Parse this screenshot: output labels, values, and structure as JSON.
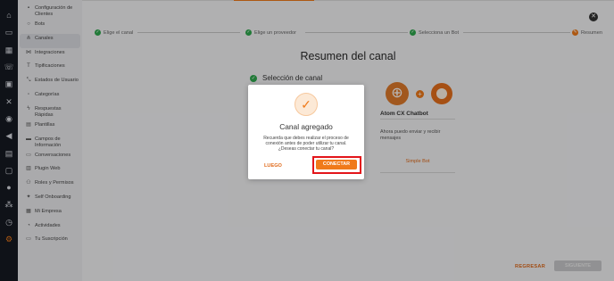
{
  "rail": {
    "icons": [
      "home-icon",
      "chat-bubbles-icon",
      "grid-icon",
      "phone-icon",
      "contacts-icon",
      "phone-off-icon",
      "whatsapp-icon",
      "megaphone-icon",
      "layers-icon",
      "message-icon",
      "user-icon",
      "team-icon",
      "alarm-clock-icon",
      "gear-icon"
    ],
    "active_index": 13
  },
  "submenu": {
    "items": [
      {
        "icon": "id-card-icon",
        "label": "Configuración de Clientes"
      },
      {
        "icon": "bot-icon",
        "label": "Bots"
      },
      {
        "icon": "channels-icon",
        "label": "Canales"
      },
      {
        "icon": "integrations-icon",
        "label": "Integraciones"
      },
      {
        "icon": "text-icon",
        "label": "Tipificaciones"
      },
      {
        "icon": "status-icon",
        "label": "Estados de Usuario"
      },
      {
        "icon": "category-icon",
        "label": "Categorías"
      },
      {
        "icon": "bolt-icon",
        "label": "Respuestas Rápidas"
      },
      {
        "icon": "template-icon",
        "label": "Plantillas"
      },
      {
        "icon": "fields-icon",
        "label": "Campos de Información"
      },
      {
        "icon": "conversations-icon",
        "label": "Conversaciones"
      },
      {
        "icon": "plugin-icon",
        "label": "Plugin Web"
      },
      {
        "icon": "roles-icon",
        "label": "Roles y Permisos"
      },
      {
        "icon": "onboarding-icon",
        "label": "Self Onboarding"
      },
      {
        "icon": "company-icon",
        "label": "Mi Empresa"
      },
      {
        "icon": "activity-icon",
        "label": "Actividades"
      },
      {
        "icon": "subscription-icon",
        "label": "Tu Suscripción"
      }
    ],
    "active_index": 2
  },
  "stepper": {
    "steps": [
      {
        "label": "Elige el canal",
        "status": "done"
      },
      {
        "label": "Elige un proveedor",
        "status": "done"
      },
      {
        "label": "Selecciona un Bot",
        "status": "done"
      },
      {
        "label": "Resumen",
        "status": "current"
      }
    ]
  },
  "page": {
    "title": "Resumen del canal",
    "selection_heading": "Selección de canal"
  },
  "bot_card": {
    "name": "Atom CX Chatbot",
    "description": "Ahora puedo enviar y recibir mensajes",
    "link": "Simple Bot"
  },
  "footer": {
    "back_label": "REGRESAR",
    "next_label": "SIGUIENTE"
  },
  "modal": {
    "title": "Canal agregado",
    "text": "Recuerda que debes realizar el proceso de conexión antes de poder utilizar tu canal. ¿Deseas conectar tu canal?",
    "later_label": "LUEGO",
    "connect_label": "CONECTAR"
  },
  "colors": {
    "accent": "#f07a1a",
    "success": "#2faa4e",
    "rail_bg": "#161a22",
    "highlight_frame": "#e3151a"
  }
}
